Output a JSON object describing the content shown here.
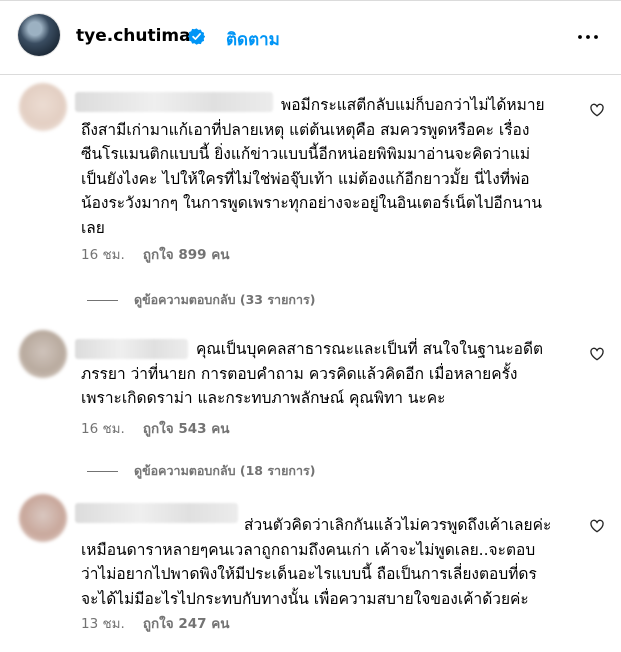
{
  "header": {
    "username": "tye.chutima",
    "follow_label": "ติดตาม",
    "icons": {
      "verified": "verified-badge-icon",
      "more": "more-options-icon"
    },
    "colors": {
      "follow": "#0095f6",
      "verified": "#0095f6"
    }
  },
  "comments": [
    {
      "text": "พอมีกระแสตีกลับแม่ก็บอกว่าไม่ได้หมาย\nถึงสามีเก่ามาแก้เอาที่ปลายเหตุ แต่ต้นเหตุคือ สมควรพูดหรือคะ เรื่อง\nซีนโรแมนติกแบบนี้ ยิ่งแก้ข่าวแบบนี้อีกหน่อยพิพิมมาอ่านจะคิดว่าแม่\nเป็นยังไงคะ ไปให้ใครที่ไม่ใช่พ่อจุ๊บเท้า แม่ต้องแก้อีกยาวมั้ย นี่ไงที่พ่อ\nน้องระวังมากๆ ในการพูดเพราะทุกอย่างจะอยู่ในอินเตอร์เน็ตไปอีกนาน\nเลย",
      "time": "16 ชม.",
      "likes": "ถูกใจ 899 คน",
      "replies": "ดูข้อความตอบกลับ (33 รายการ)"
    },
    {
      "text": "คุณเป็นบุคคลสาธารณะและเป็นที่ สนใจในฐานะอดีต\nภรรยา ว่าที่นายก การตอบคำถาม ควรคิดแล้วคิดอีก เมื่อหลายครั้ง\nเพราะเกิดดราม่า และกระทบภาพลักษณ์ คุณพิทา นะคะ",
      "time": "16 ชม.",
      "likes": "ถูกใจ 543 คน",
      "replies": "ดูข้อความตอบกลับ (18 รายการ)"
    },
    {
      "text": "ส่วนตัวคิดว่าเลิกกันแล้วไม่ควรพูดถึงเค้าเลยค่ะ\nเหมือนดาราหลายๆคนเวลาถูกถามถึงคนเก่า เค้าจะไม่พูดเลย..จะตอบ\nว่าไม่อยากไปพาดพิงให้มีประเด็นอะไรแบบนี้ ถือเป็นการเลี่ยงตอบที่ดร\nจะได้ไม่มีอะไรไปกระทบกับทางนั้น เพื่อความสบายใจของเค้าด้วยค่ะ",
      "time": "13 ชม.",
      "likes": "ถูกใจ 247 คน"
    }
  ],
  "icons": {
    "like": "heart-icon",
    "avatar": "blurred-avatar"
  }
}
